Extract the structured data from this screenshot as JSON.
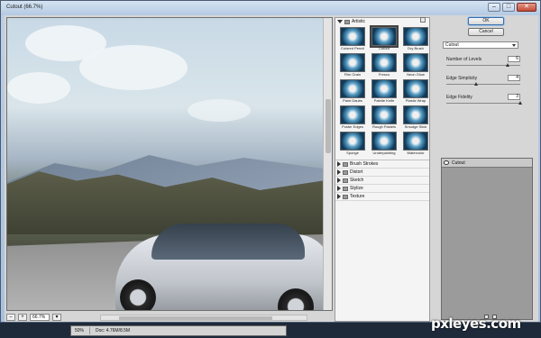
{
  "window": {
    "title": "Cutout (66.7%)",
    "controls": [
      "–",
      "□",
      "✕"
    ]
  },
  "preview": {
    "zoom_value": "66.7%",
    "zoom_minus": "–",
    "zoom_plus": "+"
  },
  "gallery": {
    "category_open": "Artistic",
    "filters": [
      "Colored Pencil",
      "Cutout",
      "Dry Brush",
      "Film Grain",
      "Fresco",
      "Neon Glow",
      "Paint Daubs",
      "Palette Knife",
      "Plastic Wrap",
      "Poster Edges",
      "Rough Pastels",
      "Smudge Stick",
      "Sponge",
      "Underpainting",
      "Watercolor"
    ],
    "selected_filter": "Cutout",
    "other_categories": [
      "Brush Strokes",
      "Distort",
      "Sketch",
      "Stylize",
      "Texture"
    ]
  },
  "settings": {
    "ok_label": "OK",
    "cancel_label": "Cancel",
    "filter_select": "Cutout",
    "params": [
      {
        "label": "Number of Levels",
        "value": "6",
        "fraction": 0.83
      },
      {
        "label": "Edge Simplicity",
        "value": "4",
        "fraction": 0.4
      },
      {
        "label": "Edge Fidelity",
        "value": "3",
        "fraction": 1.0
      }
    ]
  },
  "layers": {
    "items": [
      {
        "name": "Cutout"
      }
    ]
  },
  "status": {
    "zoom": "50%",
    "doc": "Doc: 4.76M/8.5M"
  },
  "watermark": "pxleyes.com"
}
